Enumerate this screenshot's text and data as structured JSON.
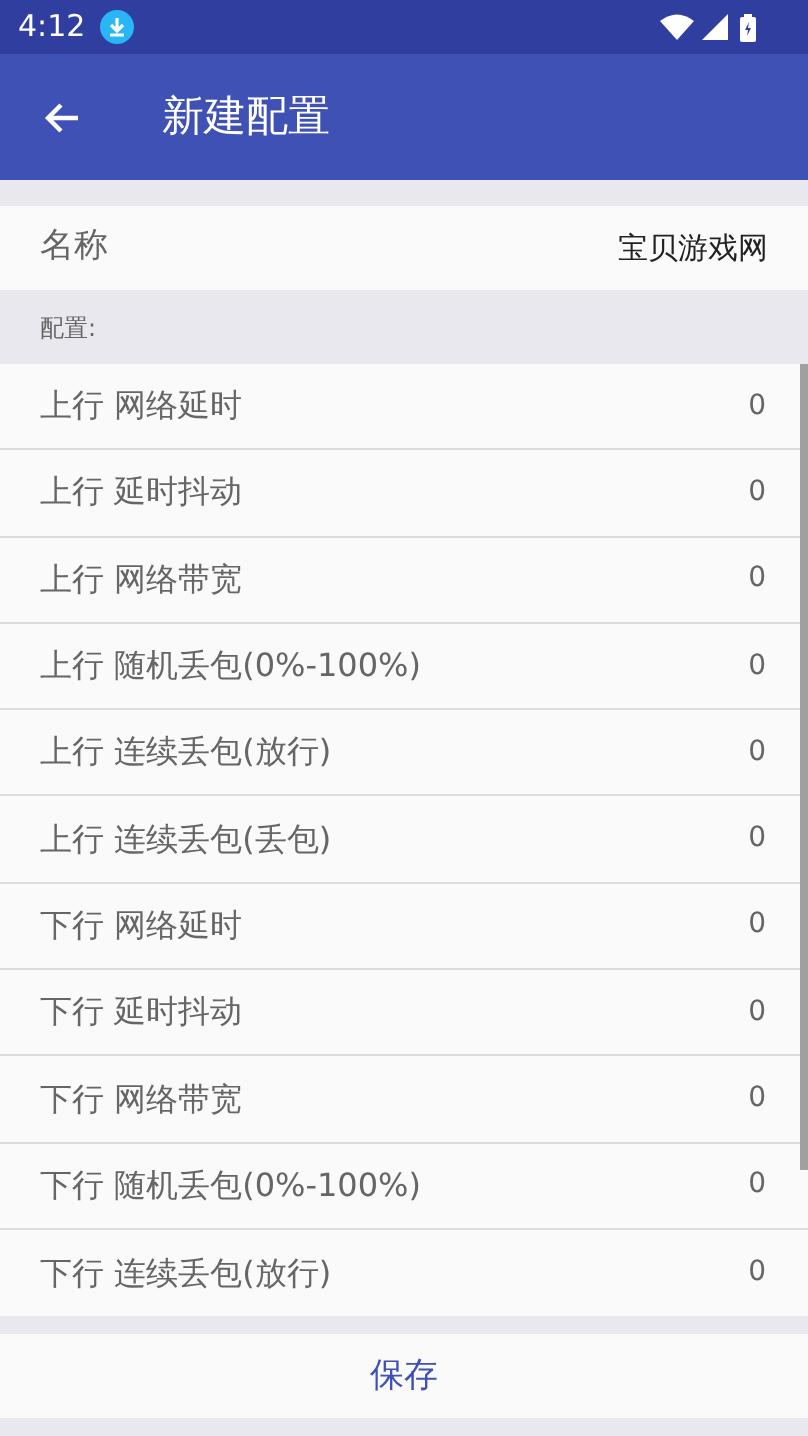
{
  "status_bar": {
    "time": "4:12"
  },
  "app_bar": {
    "title": "新建配置"
  },
  "name_row": {
    "label": "名称",
    "value": "宝贝游戏网"
  },
  "section": {
    "title": "配置:"
  },
  "settings": [
    {
      "label": "上行 网络延时",
      "value": "0"
    },
    {
      "label": "上行 延时抖动",
      "value": "0"
    },
    {
      "label": "上行 网络带宽",
      "value": "0"
    },
    {
      "label": "上行 随机丢包(0%-100%)",
      "value": "0"
    },
    {
      "label": "上行 连续丢包(放行)",
      "value": "0"
    },
    {
      "label": "上行 连续丢包(丢包)",
      "value": "0"
    },
    {
      "label": "下行 网络延时",
      "value": "0"
    },
    {
      "label": "下行 延时抖动",
      "value": "0"
    },
    {
      "label": "下行 网络带宽",
      "value": "0"
    },
    {
      "label": "下行 随机丢包(0%-100%)",
      "value": "0"
    },
    {
      "label": "下行 连续丢包(放行)",
      "value": "0"
    }
  ],
  "save_button": "保存"
}
